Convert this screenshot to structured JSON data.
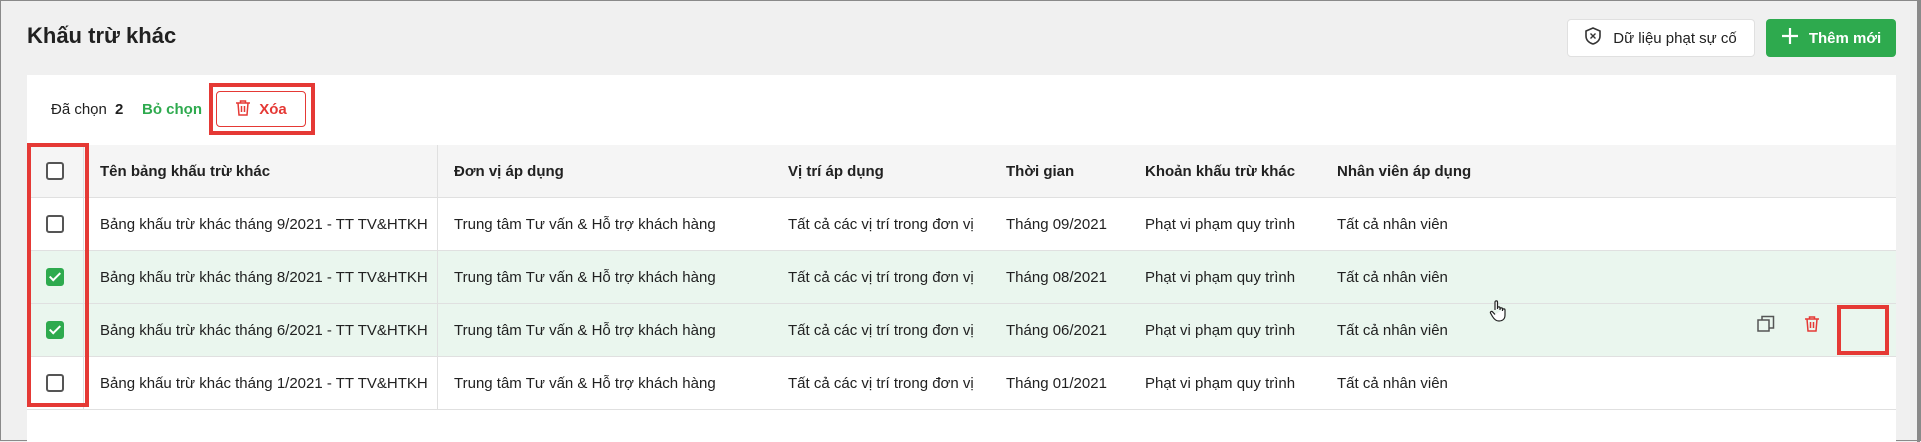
{
  "page": {
    "title": "Khấu trừ khác"
  },
  "header": {
    "data_button_label": "Dữ liệu phạt sự cố",
    "add_button_label": "Thêm mới"
  },
  "toolbar": {
    "selected_label": "Đã chọn",
    "selected_count": "2",
    "deselect_label": "Bỏ chọn",
    "delete_label": "Xóa"
  },
  "table": {
    "columns": [
      "Tên bảng khấu trừ khác",
      "Đơn vị áp dụng",
      "Vị trí áp dụng",
      "Thời gian",
      "Khoản khấu trừ khác",
      "Nhân viên áp dụng"
    ],
    "rows": [
      {
        "name": "Bảng khấu trừ khác tháng 9/2021 - TT TV&HTKH",
        "unit": "Trung tâm Tư vấn & Hỗ trợ khách hàng",
        "position": "Tất cả các vị trí trong đơn vị",
        "time": "Tháng 09/2021",
        "deduction": "Phạt vi phạm quy trình",
        "employees": "Tất cả nhân viên",
        "checked": false
      },
      {
        "name": "Bảng khấu trừ khác tháng 8/2021 - TT TV&HTKH",
        "unit": "Trung tâm Tư vấn & Hỗ trợ khách hàng",
        "position": "Tất cả các vị trí trong đơn vị",
        "time": "Tháng 08/2021",
        "deduction": "Phạt vi phạm quy trình",
        "employees": "Tất cả nhân viên",
        "checked": true
      },
      {
        "name": "Bảng khấu trừ khác tháng 6/2021 - TT TV&HTKH",
        "unit": "Trung tâm Tư vấn & Hỗ trợ khách hàng",
        "position": "Tất cả các vị trí trong đơn vị",
        "time": "Tháng 06/2021",
        "deduction": "Phạt vi phạm quy trình",
        "employees": "Tất cả nhân viên",
        "checked": true
      },
      {
        "name": "Bảng khấu trừ khác tháng 1/2021 - TT TV&HTKH",
        "unit": "Trung tâm Tư vấn & Hỗ trợ khách hàng",
        "position": "Tất cả các vị trí trong đơn vị",
        "time": "Tháng 01/2021",
        "deduction": "Phạt vi phạm quy trình",
        "employees": "Tất cả nhân viên",
        "checked": false
      }
    ]
  },
  "colors": {
    "accent": "#2eaa4e",
    "danger": "#e53935",
    "selected_row": "#eaf6ee"
  },
  "icons": [
    "shield-icon",
    "plus-icon",
    "trash-icon",
    "copy-icon",
    "cursor-hand-icon"
  ]
}
